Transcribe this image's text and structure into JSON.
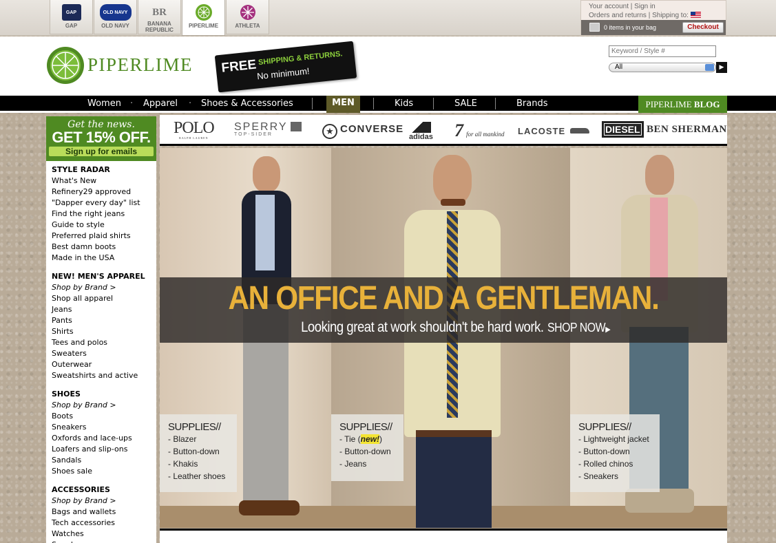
{
  "brand_tabs": [
    {
      "label": "GAP",
      "logo_text": "GAP",
      "logo_color": "#1c2a57"
    },
    {
      "label": "OLD NAVY",
      "logo_text": "OLD NAVY",
      "logo_color": "#17368e"
    },
    {
      "label": "BANANA REPUBLIC",
      "logo_text": "BR",
      "logo_color": "#888888"
    },
    {
      "label": "PIPERLIME",
      "logo_text": "",
      "logo_color": "#6aab2a"
    },
    {
      "label": "ATHLETA",
      "logo_text": "",
      "logo_color": "#a4307e"
    }
  ],
  "account": {
    "your_account": "Your account",
    "sign_in": "Sign in",
    "orders": "Orders and returns",
    "shipping": "Shipping to:",
    "bag_text": "0 items in your bag",
    "checkout": "Checkout"
  },
  "header": {
    "logo_text": "PIPERLIME",
    "free_ship_1": "FREE",
    "free_ship_2": "SHIPPING & RETURNS.",
    "free_ship_3": "No minimum!",
    "search_placeholder": "Keyword / Style #",
    "search_select": "All"
  },
  "nav": {
    "items": [
      "Women",
      "Apparel",
      "Shoes & Accessories",
      "MEN",
      "Kids",
      "SALE",
      "Brands"
    ],
    "blog_1": "PIPERLIME",
    "blog_2": "BLOG"
  },
  "promo": {
    "line1": "Get the news.",
    "line2": "GET 15% OFF.",
    "line3": "Sign up for emails"
  },
  "left_nav": {
    "style_radar": {
      "title": "STYLE RADAR",
      "items": [
        "What's New",
        "Refinery29 approved",
        "\"Dapper every day\" list",
        "Find the right jeans",
        "Guide to style",
        "Preferred plaid shirts",
        "Best damn boots",
        "Made in the USA"
      ]
    },
    "apparel": {
      "title": "NEW! MEN'S APPAREL",
      "brand": "Shop by Brand >",
      "items": [
        "Shop all apparel",
        "Jeans",
        "Pants",
        "Shirts",
        "Tees and polos",
        "Sweaters",
        "Outerwear",
        "Sweatshirts and active"
      ]
    },
    "shoes": {
      "title": "SHOES",
      "brand": "Shop by Brand >",
      "items": [
        "Boots",
        "Sneakers",
        "Oxfords and lace-ups",
        "Loafers and slip-ons",
        "Sandals",
        "Shoes sale"
      ]
    },
    "accessories": {
      "title": "ACCESSORIES",
      "brand": "Shop by Brand >",
      "items": [
        "Bags and wallets",
        "Tech accessories",
        "Watches",
        "Sunglasses"
      ]
    }
  },
  "brand_logos": [
    "POLO",
    "SPERRY",
    "CONVERSE",
    "adidas",
    "for all mankind",
    "LACOSTE",
    "DIESEL",
    "BEN SHERMAN"
  ],
  "brand_sublabels": {
    "polo": "RALPH LAUREN",
    "sperry": "TOP-SIDER"
  },
  "hero": {
    "headline": "AN OFFICE AND A GENTLEMAN.",
    "subline": "Looking great at work shouldn't be hard work.",
    "cta": "SHOP NOW",
    "supplies_title": "SUPPLIES//",
    "left_items": [
      "- Blazer",
      "- Button-down",
      "- Khakis",
      "- Leather shoes"
    ],
    "mid_items": [
      "- Button-down",
      "- Jeans"
    ],
    "mid_tie_pre": "- Tie (",
    "mid_tie_new": "new!",
    "mid_tie_post": ")",
    "right_items": [
      "- Lightweight jacket",
      "- Button-down",
      "- Rolled chinos",
      "- Sneakers"
    ]
  },
  "colors": {
    "accent_green": "#4f8a22",
    "headline_yellow": "#e8b13a",
    "nav_men_bg": "#5e5a28"
  }
}
